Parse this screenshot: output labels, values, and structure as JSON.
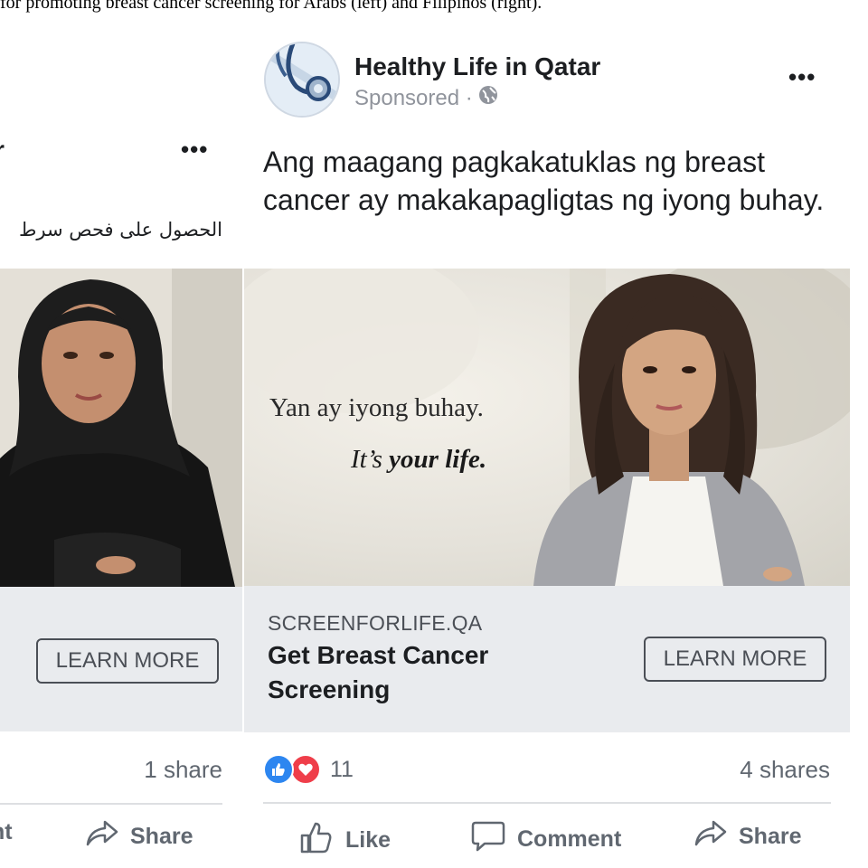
{
  "caption": "for promoting breast cancer screening for Arabs (left) and Filipinos (right).",
  "left_post": {
    "title_fragment": "r",
    "more_label": "•••",
    "arabic_text": "الحصول على فحص سرط",
    "learn_more": "LEARN MORE",
    "share_count": "1 share",
    "frag_action": "nt",
    "share_label": "Share"
  },
  "right_post": {
    "page_name": "Healthy Life in Qatar",
    "sponsored": "Sponsored ·",
    "more_label": "•••",
    "text": "Ang maagang pagkakatuklas ng breast cancer ay makakapagligtas ng iyong buhay.",
    "ad_image": {
      "line1": "Yan ay iyong buhay.",
      "line2_prefix": "It’s",
      "line2_bold": "your life."
    },
    "link": {
      "domain": "SCREENFORLIFE.QA",
      "title": "Get Breast Cancer Screening",
      "cta": "LEARN MORE"
    },
    "reactions": {
      "count": "11"
    },
    "share_count": "4 shares",
    "actions": {
      "like": "Like",
      "comment": "Comment",
      "share": "Share"
    }
  },
  "colors": {
    "fb_text": "#1c1e21",
    "meta_gray": "#90949c",
    "action_gray": "#606770",
    "panel_gray": "#e9ebee",
    "like_blue": "#2d86f0",
    "love_red": "#ef3e4a"
  }
}
